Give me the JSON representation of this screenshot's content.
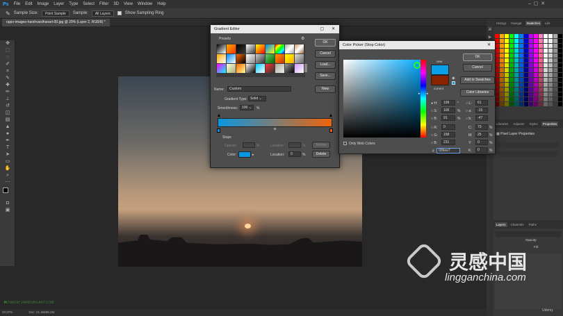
{
  "app": {
    "logo": "Ps",
    "menu": [
      "File",
      "Edit",
      "Image",
      "Layer",
      "Type",
      "Select",
      "Filter",
      "3D",
      "View",
      "Window",
      "Help"
    ]
  },
  "options_bar": {
    "sample_size_label": "Sample Size:",
    "sample_size_value": "Point Sample",
    "sample_label": "Sample:",
    "sample_value": "All Layers",
    "show_ring_label": "Show Sampling Ring"
  },
  "document_tab": {
    "title": "oppo-images-harshvardhanart-00.jpg @ 20% (Layer 2, RGB/8) *"
  },
  "gradient_editor": {
    "title": "Gradient Editor",
    "presets_label": "Presets",
    "buttons": {
      "ok": "OK",
      "cancel": "Cancel",
      "load": "Load...",
      "save": "Save...",
      "new": "New"
    },
    "name_label": "Name:",
    "name_value": "Custom",
    "type_label": "Gradient Type:",
    "type_value": "Solid",
    "smoothness_label": "Smoothness:",
    "smoothness_value": "100",
    "smoothness_unit": "%",
    "stops_label": "Stops",
    "opacity_label": "Opacity:",
    "location_label": "Location:",
    "delete_label": "Delete",
    "color_label": "Color:",
    "color_location_value": "0",
    "pct": "%",
    "gradient_start": "#0a97e0",
    "gradient_end": "#f0630a"
  },
  "color_picker": {
    "title": "Color Picker (Stop Color)",
    "buttons": {
      "ok": "OK",
      "cancel": "Cancel",
      "add": "Add to Swatches",
      "libraries": "Color Libraries"
    },
    "new_label": "new",
    "current_label": "current",
    "only_web_label": "Only Web Colors",
    "fields": {
      "H": "199",
      "S": "100",
      "B": "91",
      "R": "0",
      "G": "158",
      "Bv": "231",
      "L": "61",
      "a": "-15",
      "b": "-47",
      "C": "73",
      "M": "25",
      "Y": "0",
      "K": "0"
    },
    "units": {
      "deg": "°",
      "pct": "%"
    },
    "hex_label": "#",
    "hex_value": "009ee7",
    "new_color": "#0aa0e8",
    "current_color": "#8a2200"
  },
  "right_panel": {
    "top_tabs": [
      "Histogr",
      "Navigat",
      "Swatches",
      "Libr"
    ],
    "adjust_tabs": [
      "Libraries",
      "Adjustm",
      "Styles",
      "Properties"
    ],
    "properties_title": "Pixel Layer Properties",
    "layers_tabs": [
      "Layers",
      "Channels",
      "Paths"
    ],
    "opacity_label": "Opacity:",
    "fill_label": "Fill:"
  },
  "status": {
    "zoom": "20.07%",
    "doc": "Doc: 21.4M/86.2M"
  },
  "watermarks": {
    "left": "HARSH VARDHAN ART.COM",
    "brand_cn": "灵感中国",
    "brand_url": "lingganchina.com",
    "udemy": "Udemy"
  }
}
